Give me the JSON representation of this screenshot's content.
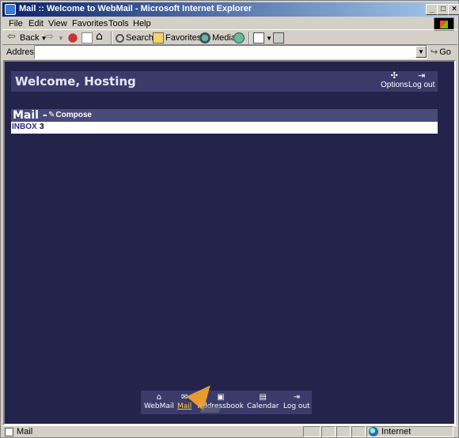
{
  "window": {
    "title": "Mail :: Welcome to WebMail - Microsoft Internet Explorer"
  },
  "menubar": [
    "File",
    "Edit",
    "View",
    "Favorites",
    "Tools",
    "Help"
  ],
  "toolbar": {
    "back": "Back",
    "search": "Search",
    "favorites": "Favorites",
    "media": "Media"
  },
  "addressbar": {
    "label": "Address",
    "value": "",
    "go": "Go"
  },
  "webmail": {
    "welcome": "Welcome, Hosting",
    "options": "Options",
    "logout": "Log out",
    "mail_title": "Mail -",
    "compose": "Compose",
    "folders": [
      {
        "name": "INBOX",
        "count": "3"
      }
    ],
    "bottom_nav": [
      {
        "label": "WebMail",
        "icon": "home-icon"
      },
      {
        "label": "Mail",
        "icon": "mail-icon",
        "active": true
      },
      {
        "label": "Addressbook",
        "icon": "addressbook-icon"
      },
      {
        "label": "Calendar",
        "icon": "calendar-icon"
      },
      {
        "label": "Log out",
        "icon": "logout-icon"
      }
    ]
  },
  "statusbar": {
    "text": "Mail",
    "zone": "Internet"
  },
  "colors": {
    "page_bg": "#23234b",
    "header_bg": "#3b3b6b",
    "active_nav": "#ffd23a"
  }
}
